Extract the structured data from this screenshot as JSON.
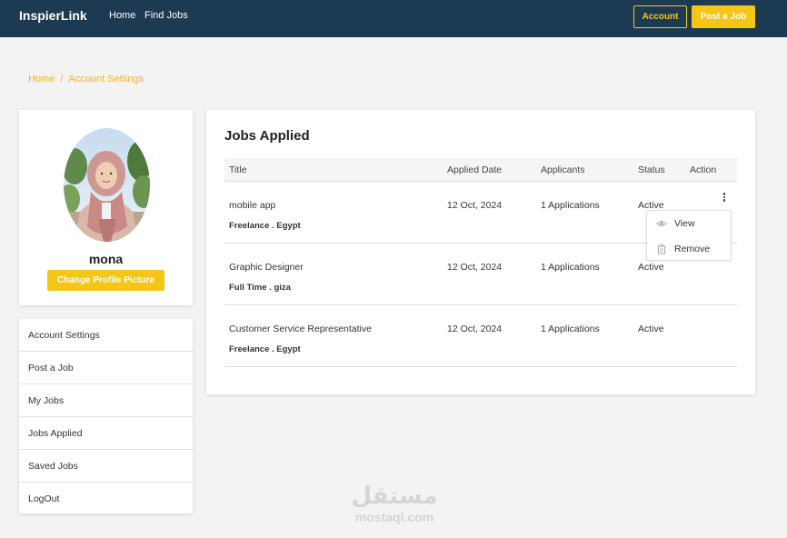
{
  "header": {
    "brand": "InspierLink",
    "nav": [
      "Home",
      "Find Jobs"
    ],
    "account_label": "Account",
    "post_job_label": "Post a Job"
  },
  "breadcrumb": {
    "home": "Home",
    "separator": "/",
    "current": "Account Settings"
  },
  "profile": {
    "username": "mona",
    "change_picture_label": "Change Profile Picture"
  },
  "side_menu": {
    "items": [
      "Account Settings",
      "Post a Job",
      "My Jobs",
      "Jobs Applied",
      "Saved Jobs",
      "LogOut"
    ]
  },
  "jobs": {
    "title": "Jobs Applied",
    "columns": [
      "Title",
      "Applied Date",
      "Applicants",
      "Status",
      "Action"
    ],
    "rows": [
      {
        "title": "mobile app",
        "subtitle": "Freelance . Egypt",
        "date": "12 Oct, 2024",
        "applicants": "1 Applications",
        "status": "Active"
      },
      {
        "title": "Graphic Designer",
        "subtitle": "Full Time . giza",
        "date": "12 Oct, 2024",
        "applicants": "1 Applications",
        "status": "Active"
      },
      {
        "title": "Customer Service Representative",
        "subtitle": "Freelance . Egypt",
        "date": "12 Oct, 2024",
        "applicants": "1 Applications",
        "status": "Active"
      }
    ]
  },
  "action_menu": {
    "view_label": "View",
    "remove_label": "Remove"
  },
  "watermark": {
    "arabic": "مستقل",
    "latin": "mostaql.com"
  },
  "colors": {
    "navbar": "#1d3a53",
    "accent": "#f5c518",
    "background": "#f3f3f3"
  },
  "icons": [
    "eye-icon",
    "trash-icon",
    "kebab-menu-icon"
  ]
}
